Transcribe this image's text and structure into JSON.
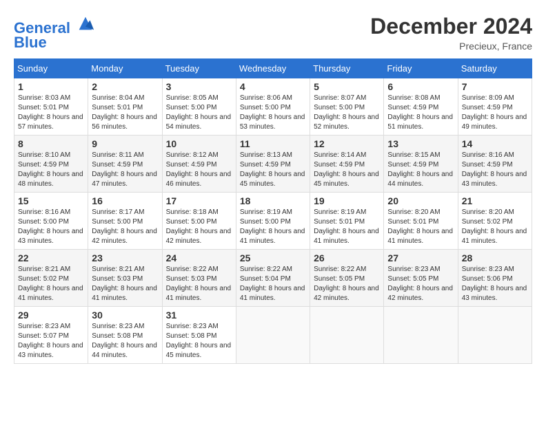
{
  "header": {
    "logo_line1": "General",
    "logo_line2": "Blue",
    "month_title": "December 2024",
    "location": "Precieux, France"
  },
  "weekdays": [
    "Sunday",
    "Monday",
    "Tuesday",
    "Wednesday",
    "Thursday",
    "Friday",
    "Saturday"
  ],
  "weeks": [
    [
      {
        "day": "1",
        "sunrise": "8:03 AM",
        "sunset": "5:01 PM",
        "daylight": "8 hours and 57 minutes."
      },
      {
        "day": "2",
        "sunrise": "8:04 AM",
        "sunset": "5:01 PM",
        "daylight": "8 hours and 56 minutes."
      },
      {
        "day": "3",
        "sunrise": "8:05 AM",
        "sunset": "5:00 PM",
        "daylight": "8 hours and 54 minutes."
      },
      {
        "day": "4",
        "sunrise": "8:06 AM",
        "sunset": "5:00 PM",
        "daylight": "8 hours and 53 minutes."
      },
      {
        "day": "5",
        "sunrise": "8:07 AM",
        "sunset": "5:00 PM",
        "daylight": "8 hours and 52 minutes."
      },
      {
        "day": "6",
        "sunrise": "8:08 AM",
        "sunset": "4:59 PM",
        "daylight": "8 hours and 51 minutes."
      },
      {
        "day": "7",
        "sunrise": "8:09 AM",
        "sunset": "4:59 PM",
        "daylight": "8 hours and 49 minutes."
      }
    ],
    [
      {
        "day": "8",
        "sunrise": "8:10 AM",
        "sunset": "4:59 PM",
        "daylight": "8 hours and 48 minutes."
      },
      {
        "day": "9",
        "sunrise": "8:11 AM",
        "sunset": "4:59 PM",
        "daylight": "8 hours and 47 minutes."
      },
      {
        "day": "10",
        "sunrise": "8:12 AM",
        "sunset": "4:59 PM",
        "daylight": "8 hours and 46 minutes."
      },
      {
        "day": "11",
        "sunrise": "8:13 AM",
        "sunset": "4:59 PM",
        "daylight": "8 hours and 45 minutes."
      },
      {
        "day": "12",
        "sunrise": "8:14 AM",
        "sunset": "4:59 PM",
        "daylight": "8 hours and 45 minutes."
      },
      {
        "day": "13",
        "sunrise": "8:15 AM",
        "sunset": "4:59 PM",
        "daylight": "8 hours and 44 minutes."
      },
      {
        "day": "14",
        "sunrise": "8:16 AM",
        "sunset": "4:59 PM",
        "daylight": "8 hours and 43 minutes."
      }
    ],
    [
      {
        "day": "15",
        "sunrise": "8:16 AM",
        "sunset": "5:00 PM",
        "daylight": "8 hours and 43 minutes."
      },
      {
        "day": "16",
        "sunrise": "8:17 AM",
        "sunset": "5:00 PM",
        "daylight": "8 hours and 42 minutes."
      },
      {
        "day": "17",
        "sunrise": "8:18 AM",
        "sunset": "5:00 PM",
        "daylight": "8 hours and 42 minutes."
      },
      {
        "day": "18",
        "sunrise": "8:19 AM",
        "sunset": "5:00 PM",
        "daylight": "8 hours and 41 minutes."
      },
      {
        "day": "19",
        "sunrise": "8:19 AM",
        "sunset": "5:01 PM",
        "daylight": "8 hours and 41 minutes."
      },
      {
        "day": "20",
        "sunrise": "8:20 AM",
        "sunset": "5:01 PM",
        "daylight": "8 hours and 41 minutes."
      },
      {
        "day": "21",
        "sunrise": "8:20 AM",
        "sunset": "5:02 PM",
        "daylight": "8 hours and 41 minutes."
      }
    ],
    [
      {
        "day": "22",
        "sunrise": "8:21 AM",
        "sunset": "5:02 PM",
        "daylight": "8 hours and 41 minutes."
      },
      {
        "day": "23",
        "sunrise": "8:21 AM",
        "sunset": "5:03 PM",
        "daylight": "8 hours and 41 minutes."
      },
      {
        "day": "24",
        "sunrise": "8:22 AM",
        "sunset": "5:03 PM",
        "daylight": "8 hours and 41 minutes."
      },
      {
        "day": "25",
        "sunrise": "8:22 AM",
        "sunset": "5:04 PM",
        "daylight": "8 hours and 41 minutes."
      },
      {
        "day": "26",
        "sunrise": "8:22 AM",
        "sunset": "5:05 PM",
        "daylight": "8 hours and 42 minutes."
      },
      {
        "day": "27",
        "sunrise": "8:23 AM",
        "sunset": "5:05 PM",
        "daylight": "8 hours and 42 minutes."
      },
      {
        "day": "28",
        "sunrise": "8:23 AM",
        "sunset": "5:06 PM",
        "daylight": "8 hours and 43 minutes."
      }
    ],
    [
      {
        "day": "29",
        "sunrise": "8:23 AM",
        "sunset": "5:07 PM",
        "daylight": "8 hours and 43 minutes."
      },
      {
        "day": "30",
        "sunrise": "8:23 AM",
        "sunset": "5:08 PM",
        "daylight": "8 hours and 44 minutes."
      },
      {
        "day": "31",
        "sunrise": "8:23 AM",
        "sunset": "5:08 PM",
        "daylight": "8 hours and 45 minutes."
      },
      null,
      null,
      null,
      null
    ]
  ]
}
